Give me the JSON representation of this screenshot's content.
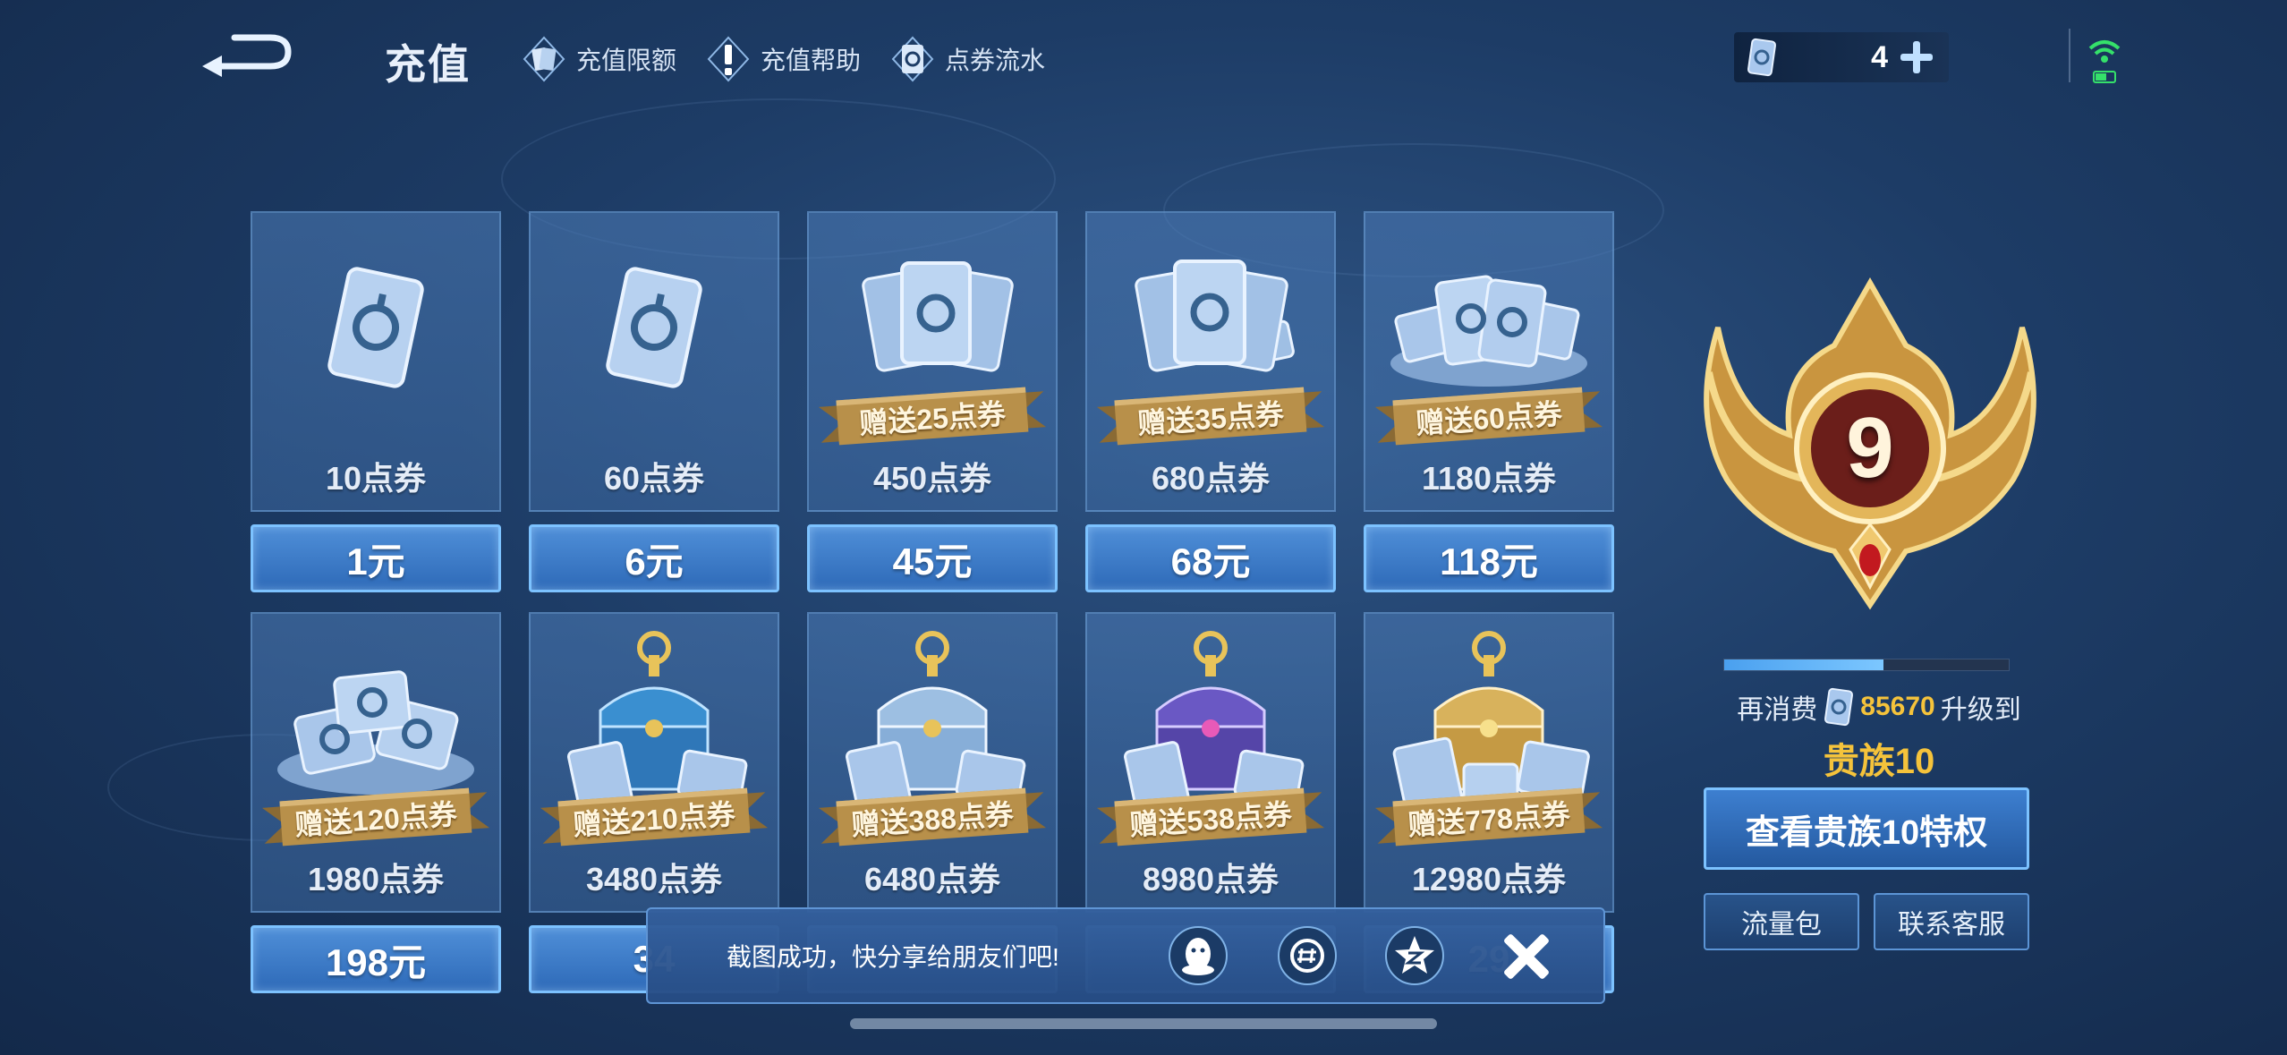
{
  "header": {
    "title": "充值",
    "links": [
      {
        "label": "充值限额",
        "icon": "card-icon"
      },
      {
        "label": "充值帮助",
        "icon": "exclamation-icon"
      },
      {
        "label": "点券流水",
        "icon": "coupon-flow-icon"
      }
    ],
    "balance": "4"
  },
  "colors": {
    "accent_blue": "#4f8fd8",
    "border_blue": "#7cc2ff",
    "gold": "#f5c33b",
    "ribbon_gold": "#b8904a"
  },
  "packages": [
    {
      "coupons": "10点券",
      "price": "1元",
      "bonus": ""
    },
    {
      "coupons": "60点券",
      "price": "6元",
      "bonus": ""
    },
    {
      "coupons": "450点券",
      "price": "45元",
      "bonus": "赠送25点券"
    },
    {
      "coupons": "680点券",
      "price": "68元",
      "bonus": "赠送35点券"
    },
    {
      "coupons": "1180点券",
      "price": "118元",
      "bonus": "赠送60点券"
    },
    {
      "coupons": "1980点券",
      "price": "198元",
      "bonus": "赠送120点券"
    },
    {
      "coupons": "3480点券",
      "price": "34",
      "bonus": "赠送210点券"
    },
    {
      "coupons": "6480点券",
      "price": "",
      "bonus": "赠送388点券"
    },
    {
      "coupons": "8980点券",
      "price": "",
      "bonus": "赠送538点券"
    },
    {
      "coupons": "12980点券",
      "price": "29",
      "bonus": "赠送778点券"
    }
  ],
  "noble": {
    "current_level": "9",
    "progress": 0.56,
    "consume_prefix": "再消费",
    "consume_amount": "85670",
    "consume_suffix": "升级到",
    "next_level": "贵族10",
    "privilege_button": "查看贵族10特权"
  },
  "buttons": {
    "traffic": "流量包",
    "service": "联系客服"
  },
  "toast": {
    "message": "截图成功，快分享给朋友们吧!"
  }
}
